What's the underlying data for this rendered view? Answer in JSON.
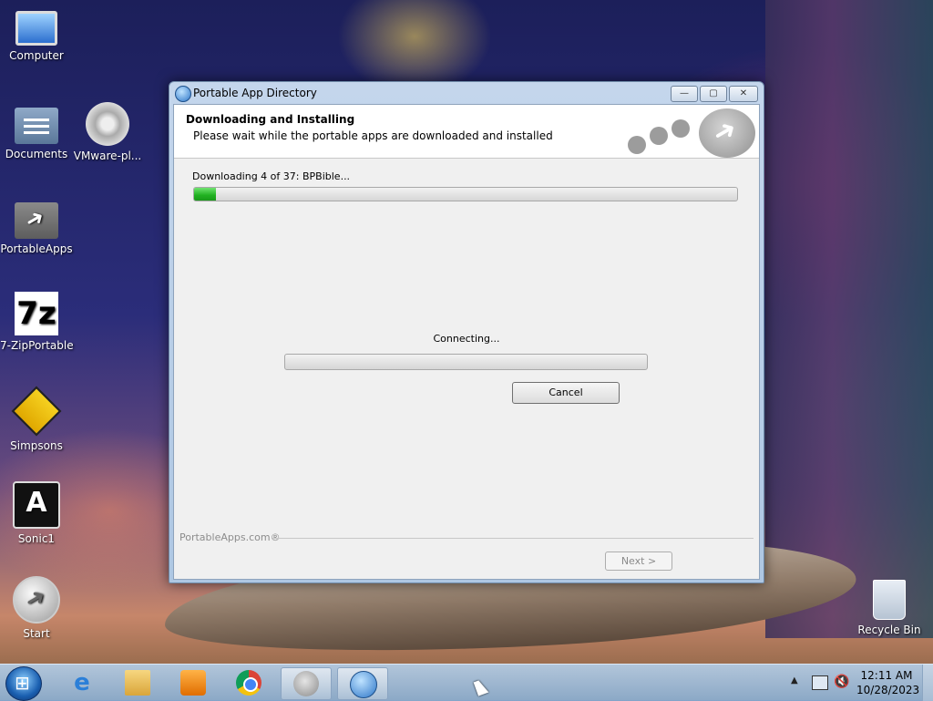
{
  "desktop": {
    "icons": [
      {
        "label": "Computer",
        "icon": "computer-icon"
      },
      {
        "label": "Documents",
        "icon": "documents-icon"
      },
      {
        "label": "VMware-pl...",
        "icon": "vmware-installer-icon"
      },
      {
        "label": "PortableApps",
        "icon": "portableapps-icon"
      },
      {
        "label": "7-ZipPortable",
        "icon": "7zip-icon"
      },
      {
        "label": "Simpsons",
        "icon": "simpsons-icon"
      },
      {
        "label": "Sonic1",
        "icon": "sonic-icon"
      },
      {
        "label": "Start",
        "icon": "portableapps-start-icon"
      },
      {
        "label": "Recycle Bin",
        "icon": "recycle-bin-icon"
      }
    ],
    "icon_glyphs": {
      "sevenzip": "7z",
      "sonic": "A"
    }
  },
  "window": {
    "title": "Portable App Directory",
    "controls": {
      "minimize": "—",
      "maximize": "▢",
      "close": "✕"
    },
    "header": {
      "title": "Downloading and Installing",
      "subtitle": "Please wait while the portable apps are downloaded and installed"
    },
    "download_status": "Downloading 4 of 37: BPBible...",
    "download_progress": 0.04,
    "connection_status": "Connecting...",
    "connection_progress": 0,
    "cancel_label": "Cancel",
    "brand": "PortableApps.com®",
    "next_label": "Next >"
  },
  "taskbar": {
    "items": [
      "internet-explorer-icon",
      "file-explorer-icon",
      "media-player-icon",
      "chrome-icon",
      "portableapps-icon",
      "portable-app-directory-icon"
    ],
    "ie_glyph": "e",
    "tray_arrow": "▲",
    "volume_glyph": "🔇",
    "time": "12:11 AM",
    "date": "10/28/2023"
  }
}
